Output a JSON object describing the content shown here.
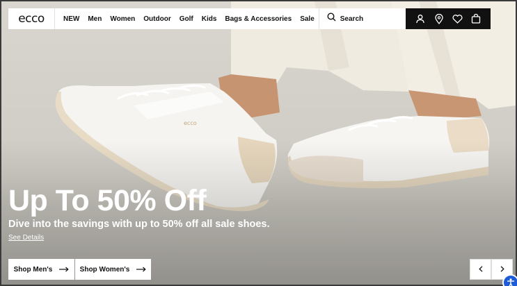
{
  "brand": {
    "logo_text": "ecco"
  },
  "nav": {
    "items": [
      {
        "id": "new",
        "label": "NEW"
      },
      {
        "id": "men",
        "label": "Men"
      },
      {
        "id": "women",
        "label": "Women"
      },
      {
        "id": "outdoor",
        "label": "Outdoor"
      },
      {
        "id": "golf",
        "label": "Golf"
      },
      {
        "id": "kids",
        "label": "Kids"
      },
      {
        "id": "bags",
        "label": "Bags & Accessories"
      },
      {
        "id": "sale",
        "label": "Sale"
      }
    ],
    "search_label": "Search",
    "icons": [
      "account-icon",
      "store-locator-icon",
      "wishlist-icon",
      "bag-icon"
    ]
  },
  "hero": {
    "headline": "Up To 50% Off",
    "subline": "Dive into the savings with up to 50% off all sale shoes.",
    "details_link": "See Details",
    "shoe_logo_text": "ecco",
    "cta": [
      {
        "id": "men",
        "label": "Shop Men's"
      },
      {
        "id": "women",
        "label": "Shop Women's"
      }
    ]
  },
  "colors": {
    "nav_background": "#ffffff",
    "icon_bar_background": "#111111",
    "text_dark": "#111111",
    "hero_text": "#ffffff",
    "accessibility_badge": "#1e5bd6"
  }
}
